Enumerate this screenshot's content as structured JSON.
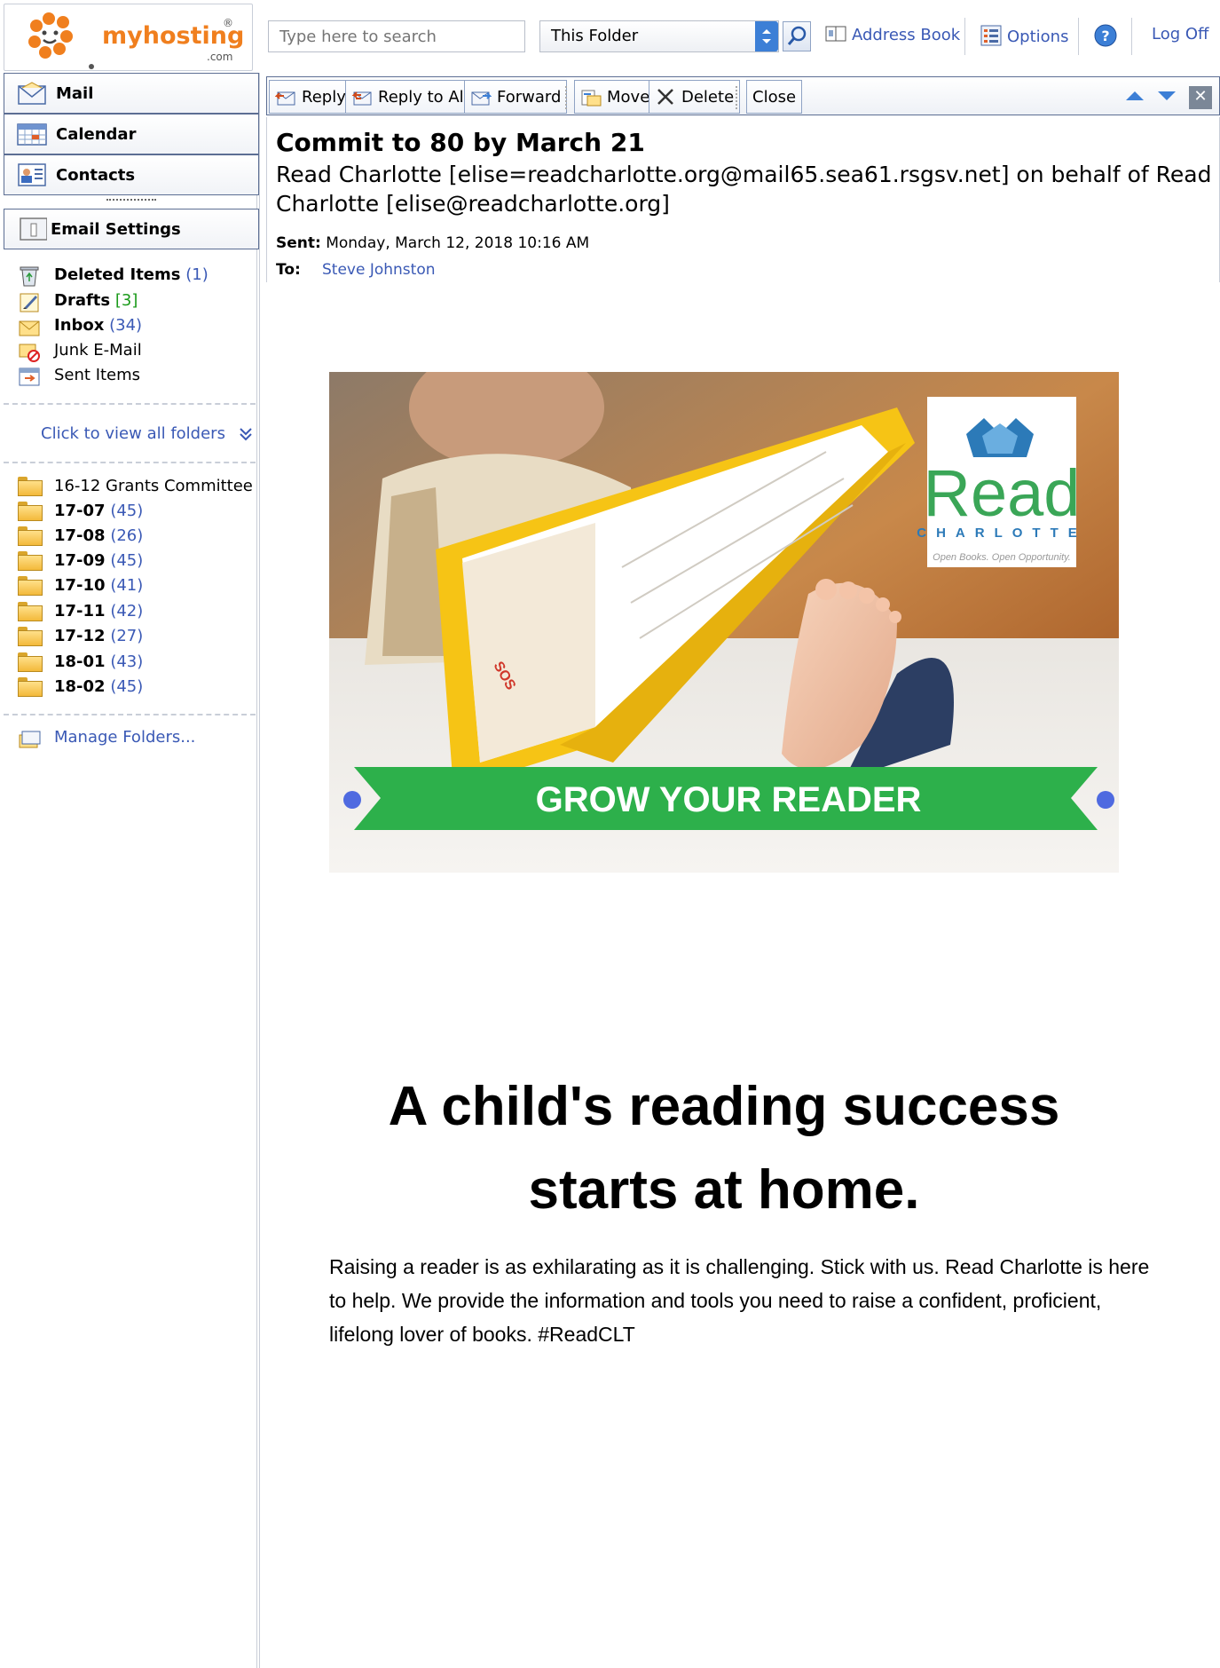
{
  "logo": {
    "brand": "myhosting",
    "suffix": ".com",
    "registered": "®"
  },
  "search": {
    "placeholder": "Type here to search",
    "scope": "This Folder"
  },
  "top_links": {
    "address_book": "Address Book",
    "options": "Options",
    "logoff": "Log Off"
  },
  "nav": {
    "mail": "Mail",
    "calendar": "Calendar",
    "contacts": "Contacts",
    "email_settings": "Email Settings"
  },
  "folders": [
    {
      "name": "Deleted Items",
      "count": "(1)",
      "bold": true
    },
    {
      "name": "Drafts",
      "count": "[3]",
      "bold": true
    },
    {
      "name": "Inbox",
      "count": "(34)",
      "bold": true
    },
    {
      "name": "Junk E-Mail",
      "count": "",
      "bold": false
    },
    {
      "name": "Sent Items",
      "count": "",
      "bold": false
    }
  ],
  "view_all_folders": "Click to view all folders",
  "custom_folders": [
    {
      "name": "16-12 Grants Committee",
      "count": ""
    },
    {
      "name": "17-07",
      "count": "(45)"
    },
    {
      "name": "17-08",
      "count": "(26)"
    },
    {
      "name": "17-09",
      "count": "(45)"
    },
    {
      "name": "17-10",
      "count": "(41)"
    },
    {
      "name": "17-11",
      "count": "(42)"
    },
    {
      "name": "17-12",
      "count": "(27)"
    },
    {
      "name": "18-01",
      "count": "(43)"
    },
    {
      "name": "18-02",
      "count": "(45)"
    }
  ],
  "manage_folders": "Manage Folders...",
  "toolbar": {
    "reply": "Reply",
    "reply_all": "Reply to All",
    "forward": "Forward",
    "move": "Move",
    "delete": "Delete",
    "close": "Close"
  },
  "message": {
    "subject": "Commit to 80 by March 21",
    "from": "Read Charlotte [elise=readcharlotte.org@mail65.sea61.rsgsv.net] on behalf of Read Charlotte [elise@readcharlotte.org]",
    "sent_label": "Sent:",
    "sent": "Monday, March 12, 2018 10:16 AM",
    "to_label": "To:",
    "to": "Steve Johnston"
  },
  "email_body": {
    "banner_text": "GROW YOUR READER",
    "logo_word": "Read",
    "logo_city": "CHARLOTTE",
    "logo_tagline": "Open Books. Open Opportunity.",
    "book_spine": "SOS",
    "headline_line1": "A child's reading success",
    "headline_line2": "starts at home.",
    "paragraph": "Raising a reader is as exhilarating as it is challenging. Stick with us. Read Charlotte is here to help. We provide the information and tools you need to raise a confident, proficient, lifelong lover of books. #ReadCLT"
  },
  "colors": {
    "link": "#3a59b5",
    "banner_green": "#2db04b",
    "accent_blue": "#3c7fd6",
    "logo_green": "#3aa657",
    "logo_blue": "#2c7ab8"
  }
}
